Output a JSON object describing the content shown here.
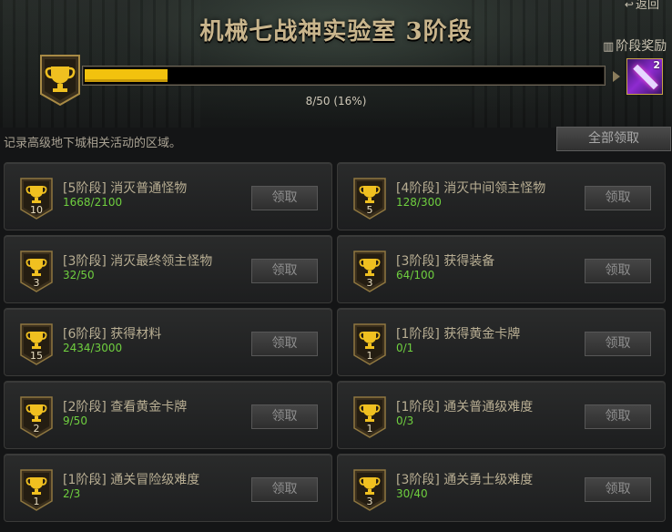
{
  "header": {
    "title": "机械七战神实验室 3阶段",
    "back_label": "返回",
    "stage_reward_label": "阶段奖励"
  },
  "progress": {
    "current": 8,
    "total": 50,
    "percent": 16,
    "text": "8/50 (16%)"
  },
  "reward_item": {
    "icon": "purple-stick-item-icon",
    "count": "2"
  },
  "description": "记录高级地下城相关活动的区域。",
  "claim_all_label": "全部领取",
  "colors": {
    "progress_fill": "#f2c20e",
    "progress_text_green": "#6fcf3f",
    "title_gold": "#c9b58c"
  },
  "tasks": [
    {
      "level": "10",
      "name": "[5阶段] 消灭普通怪物",
      "progress": "1668/2100",
      "button": "领取"
    },
    {
      "level": "5",
      "name": "[4阶段] 消灭中间领主怪物",
      "progress": "128/300",
      "button": "领取"
    },
    {
      "level": "3",
      "name": "[3阶段] 消灭最终领主怪物",
      "progress": "32/50",
      "button": "领取"
    },
    {
      "level": "3",
      "name": "[3阶段] 获得装备",
      "progress": "64/100",
      "button": "领取"
    },
    {
      "level": "15",
      "name": "[6阶段] 获得材料",
      "progress": "2434/3000",
      "button": "领取"
    },
    {
      "level": "1",
      "name": "[1阶段] 获得黄金卡牌",
      "progress": "0/1",
      "button": "领取"
    },
    {
      "level": "2",
      "name": "[2阶段] 查看黄金卡牌",
      "progress": "9/50",
      "button": "领取"
    },
    {
      "level": "1",
      "name": "[1阶段] 通关普通级难度",
      "progress": "0/3",
      "button": "领取"
    },
    {
      "level": "1",
      "name": "[1阶段] 通关冒险级难度",
      "progress": "2/3",
      "button": "领取"
    },
    {
      "level": "3",
      "name": "[3阶段] 通关勇士级难度",
      "progress": "30/40",
      "button": "领取"
    }
  ]
}
